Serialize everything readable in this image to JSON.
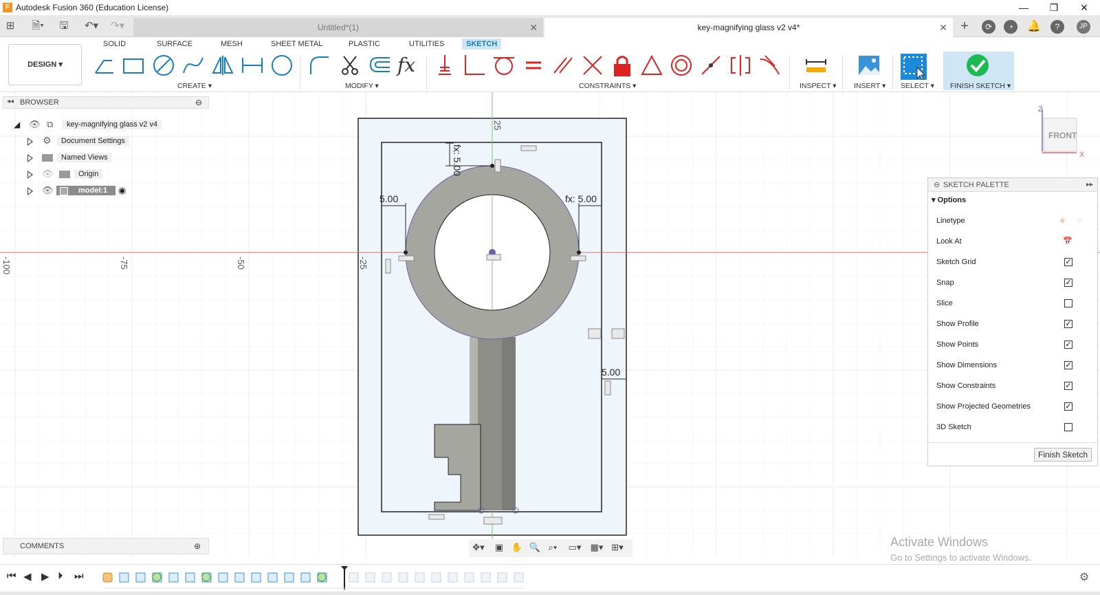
{
  "window": {
    "title": "Autodesk Fusion 360 (Education License)",
    "app_icon": "F",
    "controls": {
      "minimize": "—",
      "maximize": "❐",
      "close": "✕"
    }
  },
  "tabs": {
    "inactive_tab": "Untitled*(1)",
    "active_tab": "key-magnifying glass v2 v4*",
    "close": "✕",
    "new_tab": "+",
    "user_initials": "JP"
  },
  "ribbon": {
    "design_label": "DESIGN ▾",
    "tabs": [
      "SOLID",
      "SURFACE",
      "MESH",
      "SHEET METAL",
      "PLASTIC",
      "UTILITIES",
      "SKETCH"
    ],
    "groups": {
      "create": "CREATE ▾",
      "modify": "MODIFY ▾",
      "constraints": "CONSTRAINTS ▾",
      "inspect": "INSPECT ▾",
      "insert": "INSERT ▾",
      "select": "SELECT ▾",
      "finish": "FINISH SKETCH ▾"
    }
  },
  "browser": {
    "title": "BROWSER",
    "root": "key-magnifying glass v2 v4",
    "items": [
      "Document Settings",
      "Named Views",
      "Origin",
      "model:1"
    ]
  },
  "comments": {
    "title": "COMMENTS"
  },
  "sketch": {
    "dims": {
      "top": "fx: 5.00",
      "left": "5.00",
      "right": "fx: 5.00",
      "side": "5.00"
    },
    "axis_labels": {
      "z_top": "25",
      "x_neg100": "-100",
      "x_neg75": "-75",
      "x_neg50": "-50",
      "x_neg25": "-25"
    }
  },
  "viewcube": {
    "face": "FRONT",
    "z": "Z",
    "x": "X"
  },
  "palette": {
    "title": "SKETCH PALETTE",
    "section": "Options",
    "rows": [
      {
        "label": "Linetype",
        "type": "icons"
      },
      {
        "label": "Look At",
        "type": "icon"
      },
      {
        "label": "Sketch Grid",
        "checked": true
      },
      {
        "label": "Snap",
        "checked": true
      },
      {
        "label": "Slice",
        "checked": false
      },
      {
        "label": "Show Profile",
        "checked": true
      },
      {
        "label": "Show Points",
        "checked": true
      },
      {
        "label": "Show Dimensions",
        "checked": true
      },
      {
        "label": "Show Constraints",
        "checked": true
      },
      {
        "label": "Show Projected Geometries",
        "checked": true
      },
      {
        "label": "3D Sketch",
        "checked": false
      }
    ],
    "finish_button": "Finish Sketch"
  },
  "watermark": {
    "line1": "Activate Windows",
    "line2": "Go to Settings to activate Windows."
  },
  "colors": {
    "accent": "#1a7bc0",
    "finish_green": "#1db954",
    "body_gray": "#a6a6a0",
    "sketch_bg": "#eef6fc"
  }
}
